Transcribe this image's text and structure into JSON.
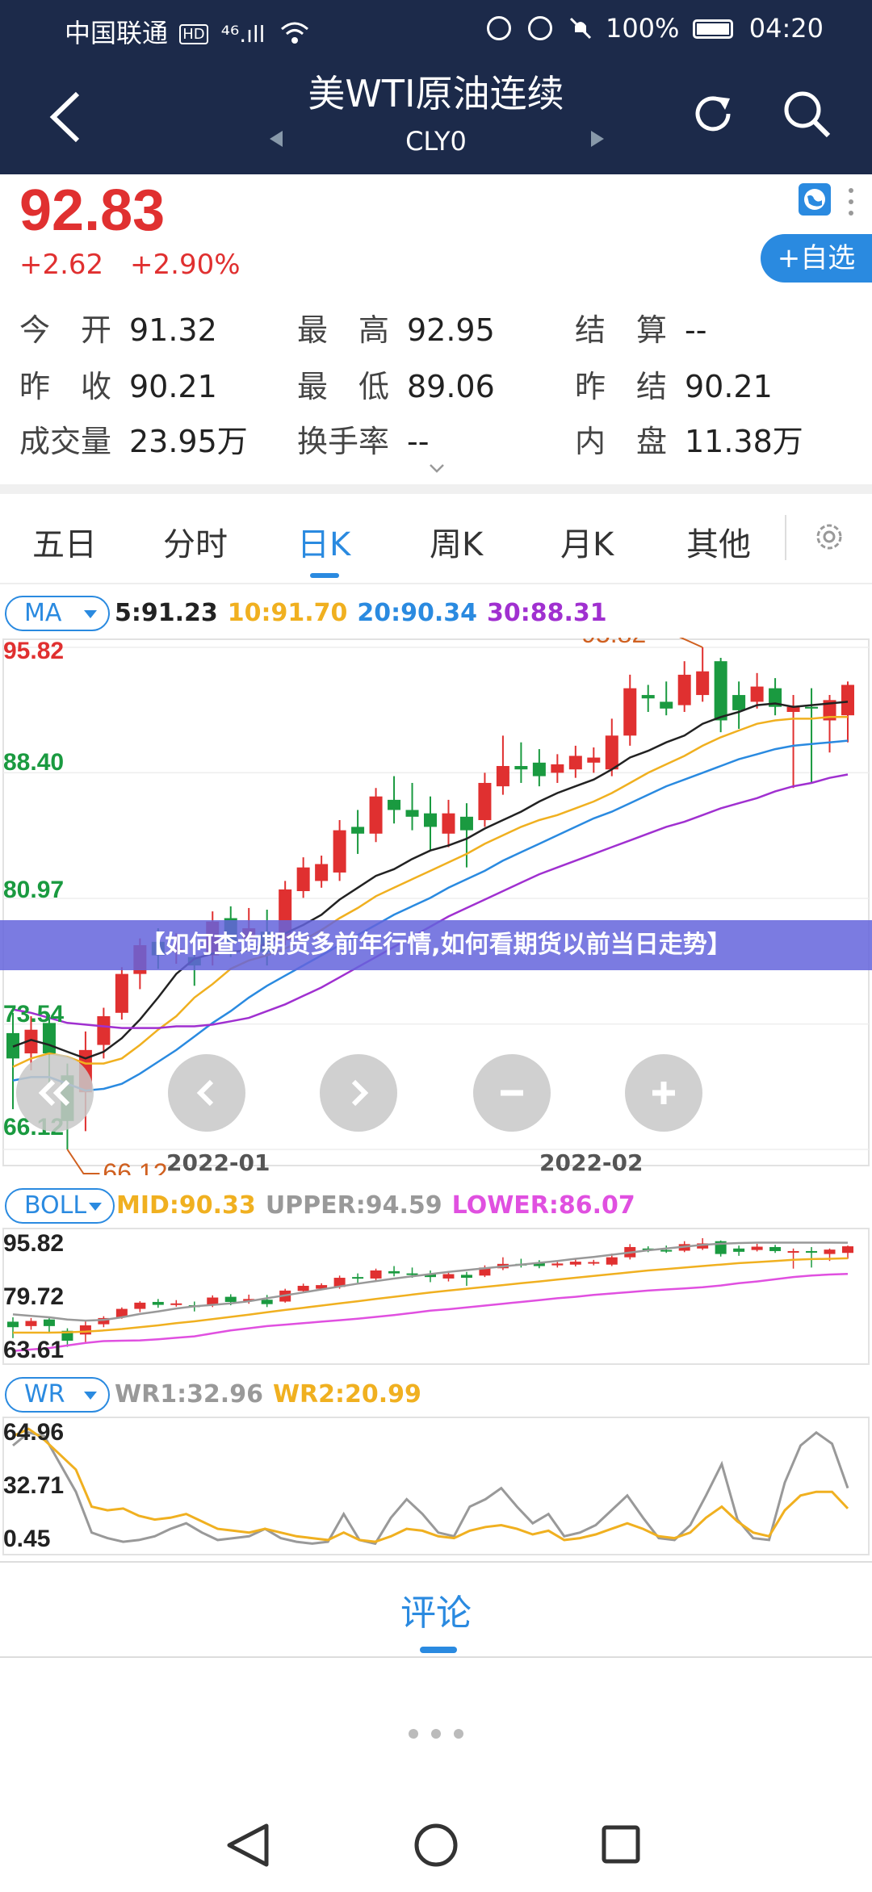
{
  "status_bar": {
    "carrier": "中国联通",
    "net_badge": "HD",
    "signal": "⁴⁶.ıll",
    "battery": "100%",
    "time": "04:20"
  },
  "nav": {
    "title": "美WTI原油连续",
    "code": "CLY0"
  },
  "quote": {
    "price": "92.83",
    "change": "+2.62",
    "change_pct": "+2.90%",
    "watch_button": "+自选",
    "fields": [
      {
        "key": "今　开",
        "value": "91.32"
      },
      {
        "key": "最　高",
        "value": "92.95"
      },
      {
        "key": "结　算",
        "value": "--"
      },
      {
        "key": "昨　收",
        "value": "90.21"
      },
      {
        "key": "最　低",
        "value": "89.06"
      },
      {
        "key": "昨　结",
        "value": "90.21"
      },
      {
        "key": "成交量",
        "value": "23.95万"
      },
      {
        "key": "换手率",
        "value": "--"
      },
      {
        "key": "内　盘",
        "value": "11.38万"
      }
    ]
  },
  "tabs": [
    {
      "label": "五日"
    },
    {
      "label": "分时"
    },
    {
      "label": "日K",
      "active": true
    },
    {
      "label": "周K"
    },
    {
      "label": "月K"
    },
    {
      "label": "其他"
    }
  ],
  "ma_legend": {
    "selector": "MA",
    "ma5": "5:91.23",
    "ma10": "10:91.70",
    "ma20": "20:90.34",
    "ma30": "30:88.31"
  },
  "boll_legend": {
    "selector": "BOLL",
    "mid": "MID:90.33",
    "upper": "UPPER:94.59",
    "lower": "LOWER:86.07"
  },
  "wr_legend": {
    "selector": "WR",
    "wr1": "WR1:32.96",
    "wr2": "WR2:20.99"
  },
  "colors": {
    "up": "#e03030",
    "down": "#1a9a40",
    "ma5": "#222222",
    "ma10": "#f0b020",
    "ma20": "#2a8ae0",
    "ma30": "#a030d0",
    "lower": "#e050e0",
    "upper": "#999999",
    "accent": "#2a8ae0"
  },
  "banner": "【如何查询期货多前年行情,如何看期货以前当日走势】",
  "comments_label": "评论",
  "chart_data": [
    {
      "type": "candlestick",
      "title": "日K",
      "y_ticks": [
        "95.82",
        "88.40",
        "80.97",
        "73.54",
        "66.12"
      ],
      "ylim": [
        66.12,
        95.82
      ],
      "x_ticks": [
        "2022-01",
        "2022-02"
      ],
      "high_label": "95.82",
      "low_label": "66.12",
      "candles": [
        {
          "o": 73.0,
          "c": 71.5,
          "h": 74.2,
          "l": 68.5
        },
        {
          "o": 71.8,
          "c": 73.2,
          "h": 74.0,
          "l": 70.8
        },
        {
          "o": 73.6,
          "c": 71.8,
          "h": 74.1,
          "l": 70.0
        },
        {
          "o": 70.5,
          "c": 67.8,
          "h": 71.2,
          "l": 66.12
        },
        {
          "o": 69.5,
          "c": 72.0,
          "h": 73.1,
          "l": 67.2
        },
        {
          "o": 72.3,
          "c": 74.0,
          "h": 74.5,
          "l": 71.5
        },
        {
          "o": 74.2,
          "c": 76.5,
          "h": 76.9,
          "l": 73.8
        },
        {
          "o": 76.5,
          "c": 78.2,
          "h": 78.6,
          "l": 75.6
        },
        {
          "o": 78.4,
          "c": 77.6,
          "h": 79.2,
          "l": 76.8
        },
        {
          "o": 77.8,
          "c": 78.0,
          "h": 78.9,
          "l": 77.1
        },
        {
          "o": 77.5,
          "c": 77.0,
          "h": 78.5,
          "l": 75.8
        },
        {
          "o": 77.6,
          "c": 79.6,
          "h": 80.2,
          "l": 77.0
        },
        {
          "o": 79.8,
          "c": 78.4,
          "h": 80.5,
          "l": 77.5
        },
        {
          "o": 78.6,
          "c": 79.2,
          "h": 80.4,
          "l": 77.9
        },
        {
          "o": 79.0,
          "c": 77.8,
          "h": 80.3,
          "l": 77.0
        },
        {
          "o": 78.5,
          "c": 81.5,
          "h": 82.0,
          "l": 78.2
        },
        {
          "o": 81.4,
          "c": 82.8,
          "h": 83.4,
          "l": 81.0
        },
        {
          "o": 82.0,
          "c": 83.0,
          "h": 83.5,
          "l": 81.6
        },
        {
          "o": 82.5,
          "c": 85.0,
          "h": 85.6,
          "l": 82.0
        },
        {
          "o": 85.2,
          "c": 84.8,
          "h": 86.2,
          "l": 83.6
        },
        {
          "o": 84.8,
          "c": 87.0,
          "h": 87.5,
          "l": 84.3
        },
        {
          "o": 86.8,
          "c": 86.2,
          "h": 88.2,
          "l": 85.4
        },
        {
          "o": 86.2,
          "c": 85.8,
          "h": 87.8,
          "l": 85.0
        },
        {
          "o": 86.0,
          "c": 85.2,
          "h": 87.0,
          "l": 83.8
        },
        {
          "o": 84.8,
          "c": 86.0,
          "h": 86.8,
          "l": 84.0
        },
        {
          "o": 85.8,
          "c": 85.0,
          "h": 86.6,
          "l": 82.8
        },
        {
          "o": 85.6,
          "c": 87.8,
          "h": 88.4,
          "l": 85.2
        },
        {
          "o": 87.6,
          "c": 88.8,
          "h": 90.6,
          "l": 87.1
        },
        {
          "o": 88.8,
          "c": 88.6,
          "h": 90.2,
          "l": 87.8
        },
        {
          "o": 89.0,
          "c": 88.2,
          "h": 89.8,
          "l": 87.6
        },
        {
          "o": 88.4,
          "c": 88.9,
          "h": 89.5,
          "l": 87.8
        },
        {
          "o": 88.6,
          "c": 89.4,
          "h": 90.0,
          "l": 88.1
        },
        {
          "o": 89.0,
          "c": 89.3,
          "h": 89.9,
          "l": 88.4
        },
        {
          "o": 88.6,
          "c": 90.6,
          "h": 91.6,
          "l": 88.2
        },
        {
          "o": 90.6,
          "c": 93.4,
          "h": 94.2,
          "l": 90.0
        },
        {
          "o": 93.0,
          "c": 92.8,
          "h": 93.6,
          "l": 92.0
        },
        {
          "o": 92.6,
          "c": 92.2,
          "h": 93.8,
          "l": 91.8
        },
        {
          "o": 92.4,
          "c": 94.2,
          "h": 95.0,
          "l": 92.0
        },
        {
          "o": 93.0,
          "c": 94.4,
          "h": 95.82,
          "l": 92.6
        },
        {
          "o": 95.0,
          "c": 91.5,
          "h": 95.2,
          "l": 90.8
        },
        {
          "o": 93.0,
          "c": 92.1,
          "h": 93.8,
          "l": 91.0
        },
        {
          "o": 92.6,
          "c": 93.5,
          "h": 94.3,
          "l": 92.2
        },
        {
          "o": 93.4,
          "c": 92.3,
          "h": 94.0,
          "l": 91.8
        },
        {
          "o": 92.0,
          "c": 92.3,
          "h": 93.0,
          "l": 87.5
        },
        {
          "o": 92.3,
          "c": 92.2,
          "h": 93.4,
          "l": 87.8
        },
        {
          "o": 91.5,
          "c": 92.7,
          "h": 93.0,
          "l": 89.6
        },
        {
          "o": 91.8,
          "c": 93.6,
          "h": 93.8,
          "l": 90.2
        }
      ],
      "series": [
        {
          "name": "5",
          "values": [
            72.2,
            72.6,
            72.3,
            71.9,
            71.5,
            71.9,
            72.7,
            73.8,
            75.1,
            76.5,
            77.4,
            77.7,
            77.8,
            77.9,
            78.3,
            78.9,
            79.4,
            80.0,
            80.9,
            81.6,
            82.3,
            82.7,
            83.3,
            83.8,
            84.1,
            84.5,
            85.1,
            85.6,
            86.1,
            86.7,
            87.2,
            87.6,
            88.0,
            88.6,
            89.3,
            89.7,
            90.2,
            90.6,
            91.3,
            91.7,
            92.0,
            92.4,
            92.5,
            92.3,
            92.4,
            92.5,
            92.6
          ]
        },
        {
          "name": "10",
          "values": [
            71.0,
            71.5,
            71.8,
            71.6,
            71.2,
            71.2,
            71.5,
            72.3,
            73.2,
            74.0,
            75.1,
            75.9,
            76.8,
            77.3,
            77.6,
            78.0,
            78.5,
            79.1,
            79.8,
            80.4,
            81.1,
            81.6,
            82.1,
            82.6,
            83.1,
            83.6,
            84.2,
            84.7,
            85.2,
            85.6,
            85.9,
            86.3,
            86.7,
            87.2,
            87.8,
            88.4,
            88.9,
            89.4,
            90.0,
            90.5,
            90.9,
            91.3,
            91.5,
            91.6,
            91.6,
            91.7,
            91.7
          ]
        },
        {
          "name": "20",
          "values": [
            70.2,
            70.4,
            70.4,
            70.0,
            69.6,
            69.7,
            70.0,
            70.6,
            71.3,
            72.0,
            72.8,
            73.6,
            74.3,
            75.1,
            75.8,
            76.4,
            77.0,
            77.6,
            78.2,
            78.8,
            79.4,
            80.0,
            80.5,
            81.0,
            81.6,
            82.1,
            82.6,
            83.2,
            83.7,
            84.2,
            84.7,
            85.2,
            85.7,
            86.1,
            86.6,
            87.1,
            87.6,
            88.0,
            88.4,
            88.8,
            89.2,
            89.5,
            89.8,
            90.0,
            90.1,
            90.2,
            90.3
          ]
        },
        {
          "name": "30",
          "values": [
            74.4,
            74.2,
            73.9,
            73.6,
            73.5,
            73.4,
            73.3,
            73.3,
            73.3,
            73.4,
            73.4,
            73.5,
            73.7,
            73.9,
            74.3,
            74.7,
            75.2,
            75.7,
            76.3,
            76.9,
            77.5,
            78.1,
            78.7,
            79.3,
            79.9,
            80.4,
            80.9,
            81.4,
            81.9,
            82.4,
            82.8,
            83.2,
            83.6,
            84.0,
            84.4,
            84.8,
            85.2,
            85.5,
            85.9,
            86.3,
            86.6,
            86.9,
            87.3,
            87.6,
            87.8,
            88.1,
            88.3
          ]
        }
      ]
    },
    {
      "type": "candlestick",
      "title": "BOLL",
      "y_ticks": [
        "95.82",
        "79.72",
        "63.61"
      ],
      "ylim": [
        63.61,
        95.82
      ],
      "series": [
        {
          "name": "MID",
          "values": [
            70.0,
            70.0,
            70.0,
            70.1,
            70.3,
            70.6,
            71.0,
            71.5,
            72.0,
            72.6,
            73.1,
            73.7,
            74.3,
            74.9,
            75.6,
            76.2,
            76.8,
            77.4,
            78.0,
            78.6,
            79.2,
            79.8,
            80.4,
            81.0,
            81.5,
            82.0,
            82.5,
            83.0,
            83.5,
            84.0,
            84.5,
            85.0,
            85.5,
            86.0,
            86.5,
            87.0,
            87.4,
            87.8,
            88.2,
            88.6,
            89.0,
            89.3,
            89.6,
            89.9,
            90.1,
            90.2,
            90.33
          ]
        },
        {
          "name": "UPPER",
          "values": [
            75.0,
            74.6,
            74.2,
            73.6,
            73.3,
            73.5,
            74.2,
            75.1,
            75.8,
            76.6,
            77.2,
            77.6,
            78.0,
            78.6,
            79.4,
            80.2,
            81.0,
            81.8,
            82.6,
            83.4,
            84.1,
            84.8,
            85.4,
            86.0,
            86.6,
            87.1,
            87.6,
            88.1,
            88.6,
            89.1,
            89.6,
            90.2,
            90.7,
            91.3,
            91.9,
            92.5,
            93.0,
            93.5,
            94.0,
            94.3,
            94.5,
            94.6,
            94.6,
            94.6,
            94.6,
            94.6,
            94.59
          ]
        },
        {
          "name": "LOWER",
          "values": [
            65.0,
            65.4,
            65.8,
            66.5,
            67.2,
            67.7,
            67.8,
            67.9,
            68.2,
            68.6,
            69.0,
            69.8,
            70.6,
            71.2,
            71.8,
            72.2,
            72.6,
            73.0,
            73.4,
            73.8,
            74.3,
            74.8,
            75.4,
            76.0,
            76.4,
            76.9,
            77.4,
            77.9,
            78.4,
            78.9,
            79.4,
            79.8,
            80.3,
            80.7,
            81.1,
            81.5,
            81.8,
            82.1,
            82.4,
            82.9,
            83.5,
            84.0,
            84.6,
            85.2,
            85.6,
            85.9,
            86.07
          ]
        }
      ]
    },
    {
      "type": "line",
      "title": "WR",
      "y_ticks": [
        "64.96",
        "32.71",
        "0.45"
      ],
      "ylim": [
        0.45,
        64.96
      ],
      "series": [
        {
          "name": "WR1",
          "values": [
            55,
            62,
            60,
            45,
            30,
            8,
            5,
            3,
            4,
            6,
            10,
            13,
            8,
            4,
            5,
            6,
            10,
            5,
            3,
            2,
            3,
            18,
            4,
            2,
            16,
            26,
            18,
            8,
            6,
            22,
            26,
            32,
            22,
            13,
            18,
            6,
            8,
            12,
            20,
            28,
            16,
            5,
            4,
            12,
            28,
            45,
            15,
            5,
            4,
            35,
            55,
            62,
            56,
            32
          ]
        },
        {
          "name": "WR2",
          "values": [
            60,
            64,
            58,
            50,
            42,
            22,
            20,
            21,
            17,
            15,
            16,
            18,
            14,
            10,
            9,
            8,
            10,
            8,
            6,
            5,
            4,
            8,
            4,
            3,
            6,
            10,
            9,
            6,
            5,
            9,
            11,
            12,
            10,
            7,
            9,
            4,
            5,
            7,
            10,
            13,
            10,
            6,
            5,
            8,
            16,
            22,
            14,
            8,
            6,
            20,
            28,
            30,
            30,
            21
          ]
        }
      ]
    }
  ]
}
